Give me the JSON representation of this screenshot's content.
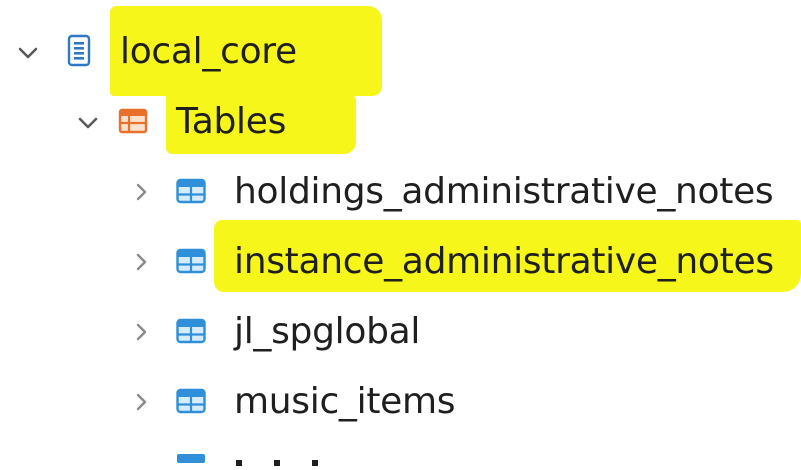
{
  "tree": {
    "database": {
      "label": "local_core",
      "expanded": true,
      "icon": "database-icon"
    },
    "tables_folder": {
      "label": "Tables",
      "expanded": true,
      "icon": "tables-folder-icon"
    },
    "tables": [
      {
        "label": "holdings_administrative_notes",
        "expanded": false,
        "highlighted": false,
        "icon": "table-icon"
      },
      {
        "label": "instance_administrative_notes",
        "expanded": false,
        "highlighted": true,
        "icon": "table-icon"
      },
      {
        "label": "jl_spglobal",
        "expanded": false,
        "highlighted": false,
        "icon": "table-icon"
      },
      {
        "label": "music_items",
        "expanded": false,
        "highlighted": false,
        "icon": "table-icon"
      }
    ]
  },
  "colors": {
    "highlight": "#f6f61a",
    "table_icon": "#2f8fd8",
    "folder_icon": "#e8702a",
    "db_icon": "#2f78c4",
    "chevron": "#6b6b6b",
    "text": "#1f1f1f"
  }
}
